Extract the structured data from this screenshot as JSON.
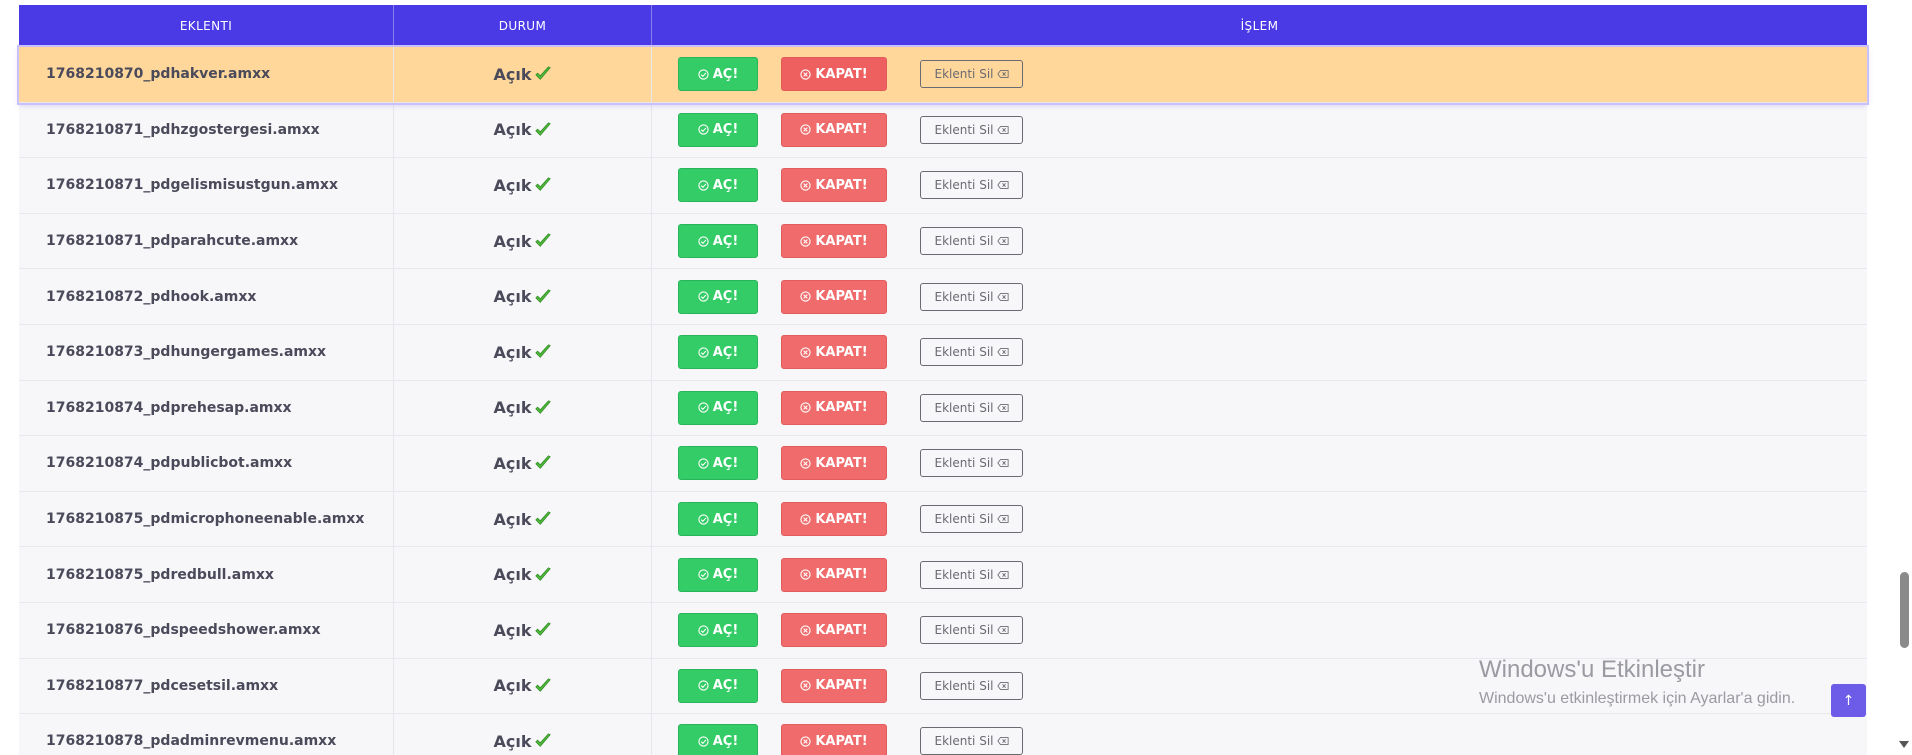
{
  "table": {
    "headers": {
      "plugin": "EKLENTI",
      "status": "DURUM",
      "action": "İŞLEM"
    },
    "actions": {
      "open_label": "AÇ!",
      "close_label": "KAPAT!",
      "delete_label": "Eklenti Sil"
    },
    "rows": [
      {
        "name": "1768210870_pdhakver.amxx",
        "status": "Açık"
      },
      {
        "name": "1768210871_pdhzgostergesi.amxx",
        "status": "Açık"
      },
      {
        "name": "1768210871_pdgelismisustgun.amxx",
        "status": "Açık"
      },
      {
        "name": "1768210871_pdparahcute.amxx",
        "status": "Açık"
      },
      {
        "name": "1768210872_pdhook.amxx",
        "status": "Açık"
      },
      {
        "name": "1768210873_pdhungergames.amxx",
        "status": "Açık"
      },
      {
        "name": "1768210874_pdprehesap.amxx",
        "status": "Açık"
      },
      {
        "name": "1768210874_pdpublicbot.amxx",
        "status": "Açık"
      },
      {
        "name": "1768210875_pdmicrophoneenable.amxx",
        "status": "Açık"
      },
      {
        "name": "1768210875_pdredbull.amxx",
        "status": "Açık"
      },
      {
        "name": "1768210876_pdspeedshower.amxx",
        "status": "Açık"
      },
      {
        "name": "1768210877_pdcesetsil.amxx",
        "status": "Açık"
      },
      {
        "name": "1768210878_pdadminrevmenu.amxx",
        "status": "Açık"
      }
    ],
    "highlighted_row": 0
  },
  "watermark": {
    "title": "Windows'u Etkinleştir",
    "subtitle": "Windows'u etkinleştirmek için Ayarlar'a gidin."
  },
  "colors": {
    "header_bg": "#4a3ae6",
    "open_green": "#33cc66",
    "close_red": "#f06b6b",
    "highlight_row": "#ffd79b"
  },
  "icons": {
    "open": "check-circle-icon",
    "close": "x-circle-icon",
    "delete": "backspace-icon",
    "status": "checkmark-icon",
    "scroll_top": "arrow-up-icon"
  }
}
